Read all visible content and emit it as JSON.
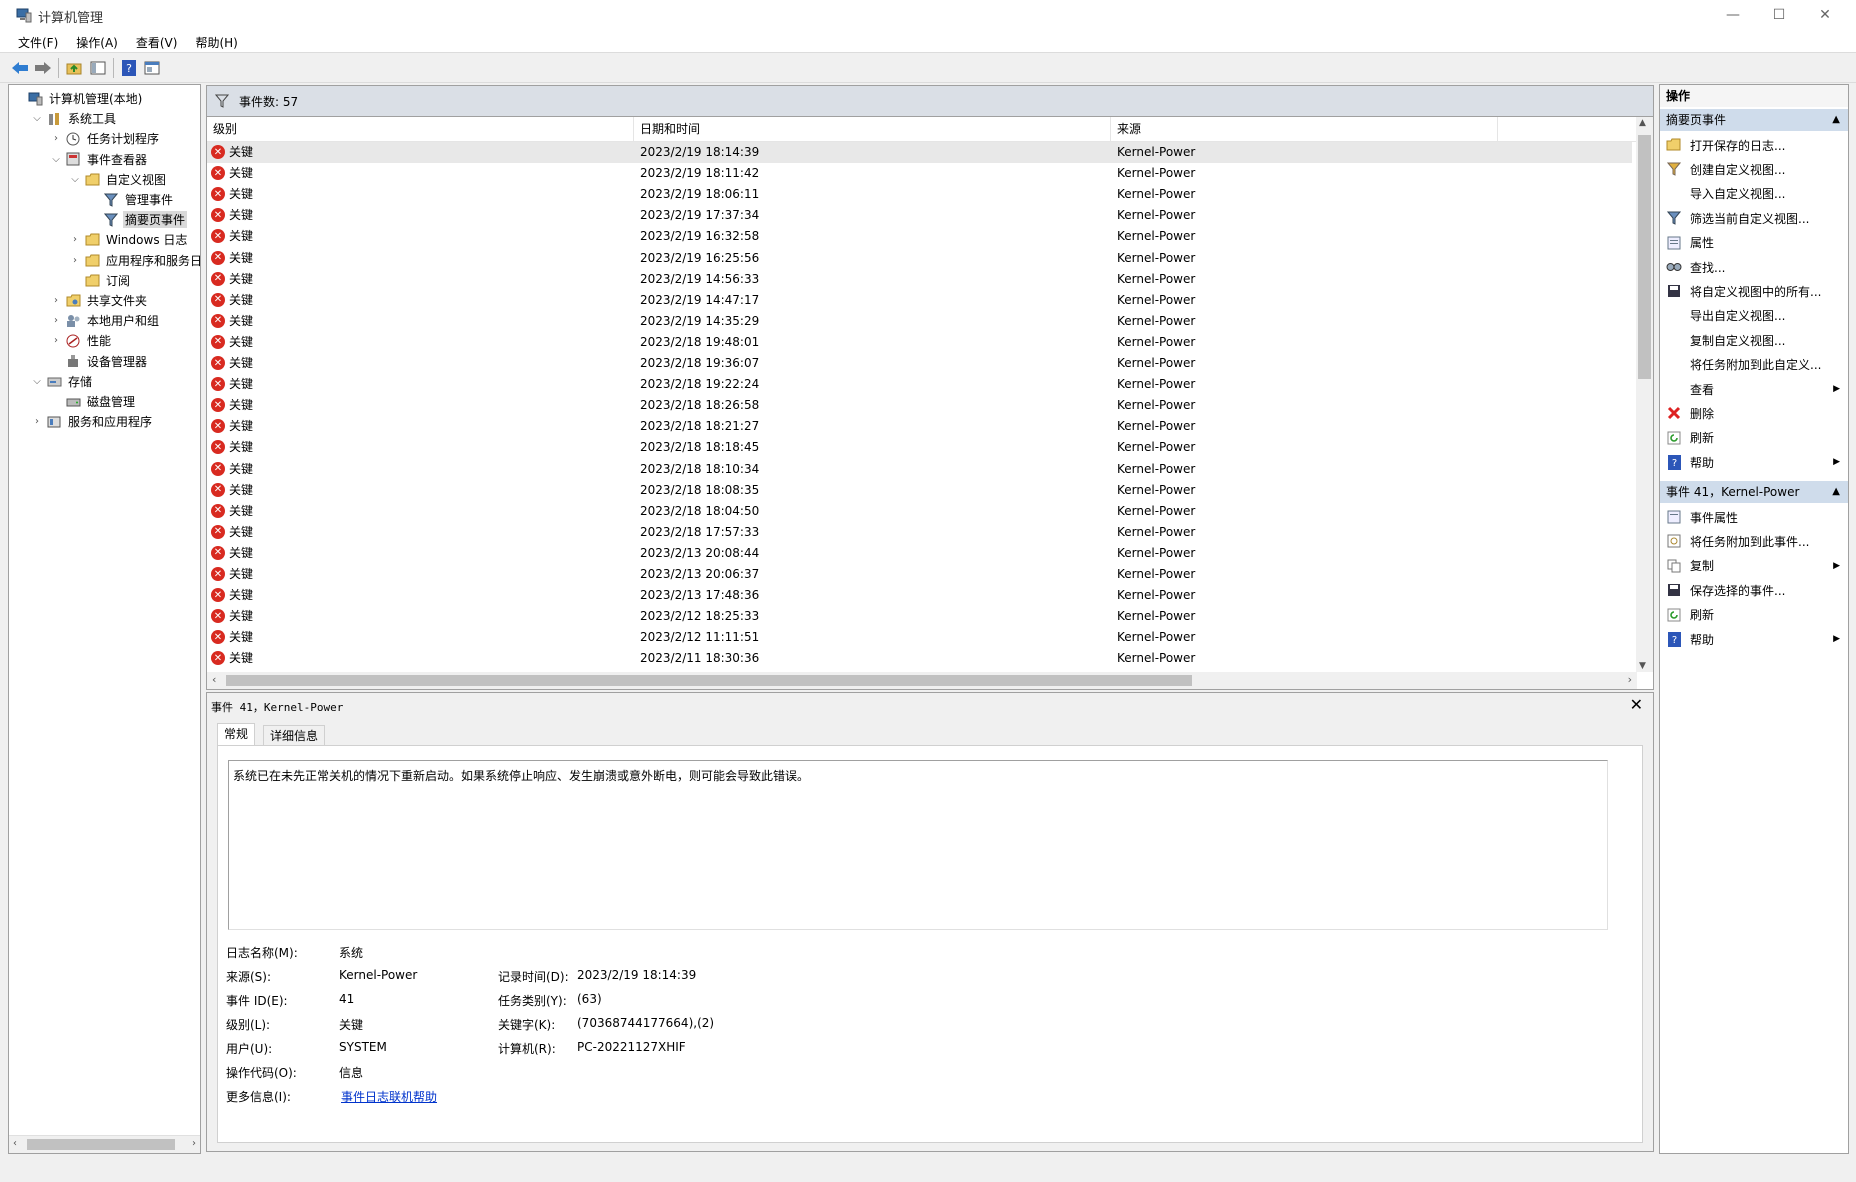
{
  "window": {
    "title": "计算机管理",
    "min": "—",
    "max": "☐",
    "close": "✕"
  },
  "menu": [
    "文件(F)",
    "操作(A)",
    "查看(V)",
    "帮助(H)"
  ],
  "toolbar": [
    "back-icon",
    "forward-icon",
    "up-folder-icon",
    "show-hide-tree-icon",
    "help-icon",
    "properties-icon"
  ],
  "tree": [
    {
      "label": "计算机管理(本地)",
      "level": 0,
      "expander": "",
      "icon": "computer-icon"
    },
    {
      "label": "系统工具",
      "level": 1,
      "expander": "⌵",
      "icon": "tools-icon"
    },
    {
      "label": "任务计划程序",
      "level": 2,
      "expander": "›",
      "icon": "clock-icon"
    },
    {
      "label": "事件查看器",
      "level": 2,
      "expander": "⌵",
      "icon": "event-viewer-icon"
    },
    {
      "label": "自定义视图",
      "level": 3,
      "expander": "⌵",
      "icon": "folder-icon"
    },
    {
      "label": "管理事件",
      "level": 4,
      "expander": "",
      "icon": "filter-icon"
    },
    {
      "label": "摘要页事件",
      "level": 4,
      "expander": "",
      "icon": "filter-icon",
      "selected": true
    },
    {
      "label": "Windows 日志",
      "level": 3,
      "expander": "›",
      "icon": "folder-icon"
    },
    {
      "label": "应用程序和服务日志",
      "level": 3,
      "expander": "›",
      "icon": "folder-icon"
    },
    {
      "label": "订阅",
      "level": 3,
      "expander": "",
      "icon": "folder-icon"
    },
    {
      "label": "共享文件夹",
      "level": 2,
      "expander": "›",
      "icon": "shared-folder-icon"
    },
    {
      "label": "本地用户和组",
      "level": 2,
      "expander": "›",
      "icon": "users-icon"
    },
    {
      "label": "性能",
      "level": 2,
      "expander": "›",
      "icon": "performance-icon"
    },
    {
      "label": "设备管理器",
      "level": 2,
      "expander": "",
      "icon": "device-manager-icon"
    },
    {
      "label": "存储",
      "level": 1,
      "expander": "⌵",
      "icon": "storage-icon"
    },
    {
      "label": "磁盘管理",
      "level": 2,
      "expander": "",
      "icon": "disk-icon"
    },
    {
      "label": "服务和应用程序",
      "level": 1,
      "expander": "›",
      "icon": "services-icon"
    }
  ],
  "events": {
    "count_label": "事件数: 57",
    "columns": [
      "级别",
      "日期和时间",
      "来源"
    ],
    "rows": [
      {
        "level": "关键",
        "datetime": "2023/2/19 18:14:39",
        "source": "Kernel-Power",
        "selected": true
      },
      {
        "level": "关键",
        "datetime": "2023/2/19 18:11:42",
        "source": "Kernel-Power"
      },
      {
        "level": "关键",
        "datetime": "2023/2/19 18:06:11",
        "source": "Kernel-Power"
      },
      {
        "level": "关键",
        "datetime": "2023/2/19 17:37:34",
        "source": "Kernel-Power"
      },
      {
        "level": "关键",
        "datetime": "2023/2/19 16:32:58",
        "source": "Kernel-Power"
      },
      {
        "level": "关键",
        "datetime": "2023/2/19 16:25:56",
        "source": "Kernel-Power"
      },
      {
        "level": "关键",
        "datetime": "2023/2/19 14:56:33",
        "source": "Kernel-Power"
      },
      {
        "level": "关键",
        "datetime": "2023/2/19 14:47:17",
        "source": "Kernel-Power"
      },
      {
        "level": "关键",
        "datetime": "2023/2/19 14:35:29",
        "source": "Kernel-Power"
      },
      {
        "level": "关键",
        "datetime": "2023/2/18 19:48:01",
        "source": "Kernel-Power"
      },
      {
        "level": "关键",
        "datetime": "2023/2/18 19:36:07",
        "source": "Kernel-Power"
      },
      {
        "level": "关键",
        "datetime": "2023/2/18 19:22:24",
        "source": "Kernel-Power"
      },
      {
        "level": "关键",
        "datetime": "2023/2/18 18:26:58",
        "source": "Kernel-Power"
      },
      {
        "level": "关键",
        "datetime": "2023/2/18 18:21:27",
        "source": "Kernel-Power"
      },
      {
        "level": "关键",
        "datetime": "2023/2/18 18:18:45",
        "source": "Kernel-Power"
      },
      {
        "level": "关键",
        "datetime": "2023/2/18 18:10:34",
        "source": "Kernel-Power"
      },
      {
        "level": "关键",
        "datetime": "2023/2/18 18:08:35",
        "source": "Kernel-Power"
      },
      {
        "level": "关键",
        "datetime": "2023/2/18 18:04:50",
        "source": "Kernel-Power"
      },
      {
        "level": "关键",
        "datetime": "2023/2/18 17:57:33",
        "source": "Kernel-Power"
      },
      {
        "level": "关键",
        "datetime": "2023/2/13 20:08:44",
        "source": "Kernel-Power"
      },
      {
        "level": "关键",
        "datetime": "2023/2/13 20:06:37",
        "source": "Kernel-Power"
      },
      {
        "level": "关键",
        "datetime": "2023/2/13 17:48:36",
        "source": "Kernel-Power"
      },
      {
        "level": "关键",
        "datetime": "2023/2/12 18:25:33",
        "source": "Kernel-Power"
      },
      {
        "level": "关键",
        "datetime": "2023/2/12 11:11:51",
        "source": "Kernel-Power"
      },
      {
        "level": "关键",
        "datetime": "2023/2/11 18:30:36",
        "source": "Kernel-Power"
      }
    ]
  },
  "details": {
    "title": "事件 41，Kernel-Power",
    "close": "✕",
    "tabs": [
      "常规",
      "详细信息"
    ],
    "description": "系统已在未先正常关机的情况下重新启动。如果系统停止响应、发生崩溃或意外断电，则可能会导致此错误。",
    "log_name_label": "日志名称(M):",
    "log_name": "系统",
    "source_label": "来源(S):",
    "source": "Kernel-Power",
    "logged_label": "记录时间(D):",
    "logged": "2023/2/19 18:14:39",
    "event_id_label": "事件 ID(E):",
    "event_id": "41",
    "task_label": "任务类别(Y):",
    "task": "(63)",
    "level_label": "级别(L):",
    "level": "关键",
    "keywords_label": "关键字(K):",
    "keywords": "(70368744177664),(2)",
    "user_label": "用户(U):",
    "user": "SYSTEM",
    "computer_label": "计算机(R):",
    "computer": "PC-20221127XHIF",
    "opcode_label": "操作代码(O):",
    "opcode": "信息",
    "more_label": "更多信息(I):",
    "more_link": "事件日志联机帮助"
  },
  "actions": {
    "title": "操作",
    "section1": "摘要页事件",
    "items1": [
      {
        "label": "打开保存的日志...",
        "icon": "open-log-icon"
      },
      {
        "label": "创建自定义视图...",
        "icon": "create-view-icon"
      },
      {
        "label": "导入自定义视图...",
        "icon": ""
      },
      {
        "label": "筛选当前自定义视图...",
        "icon": "filter-icon"
      },
      {
        "label": "属性",
        "icon": "properties-icon"
      },
      {
        "label": "查找...",
        "icon": "find-icon"
      },
      {
        "label": "将自定义视图中的所有...",
        "icon": "save-icon"
      },
      {
        "label": "导出自定义视图...",
        "icon": ""
      },
      {
        "label": "复制自定义视图...",
        "icon": ""
      },
      {
        "label": "将任务附加到此自定义...",
        "icon": ""
      },
      {
        "label": "查看",
        "icon": "",
        "sub": true
      },
      {
        "label": "删除",
        "icon": "delete-icon"
      },
      {
        "label": "刷新",
        "icon": "refresh-icon"
      },
      {
        "label": "帮助",
        "icon": "help-icon",
        "sub": true
      }
    ],
    "section2": "事件 41，Kernel-Power",
    "items2": [
      {
        "label": "事件属性",
        "icon": "event-properties-icon"
      },
      {
        "label": "将任务附加到此事件...",
        "icon": "attach-task-icon"
      },
      {
        "label": "复制",
        "icon": "copy-icon",
        "sub": true
      },
      {
        "label": "保存选择的事件...",
        "icon": "save-icon"
      },
      {
        "label": "刷新",
        "icon": "refresh-icon"
      },
      {
        "label": "帮助",
        "icon": "help-icon",
        "sub": true
      }
    ]
  },
  "colors": {
    "critical": "#d82a20",
    "section": "#cfdceb",
    "link": "#0033cc"
  }
}
